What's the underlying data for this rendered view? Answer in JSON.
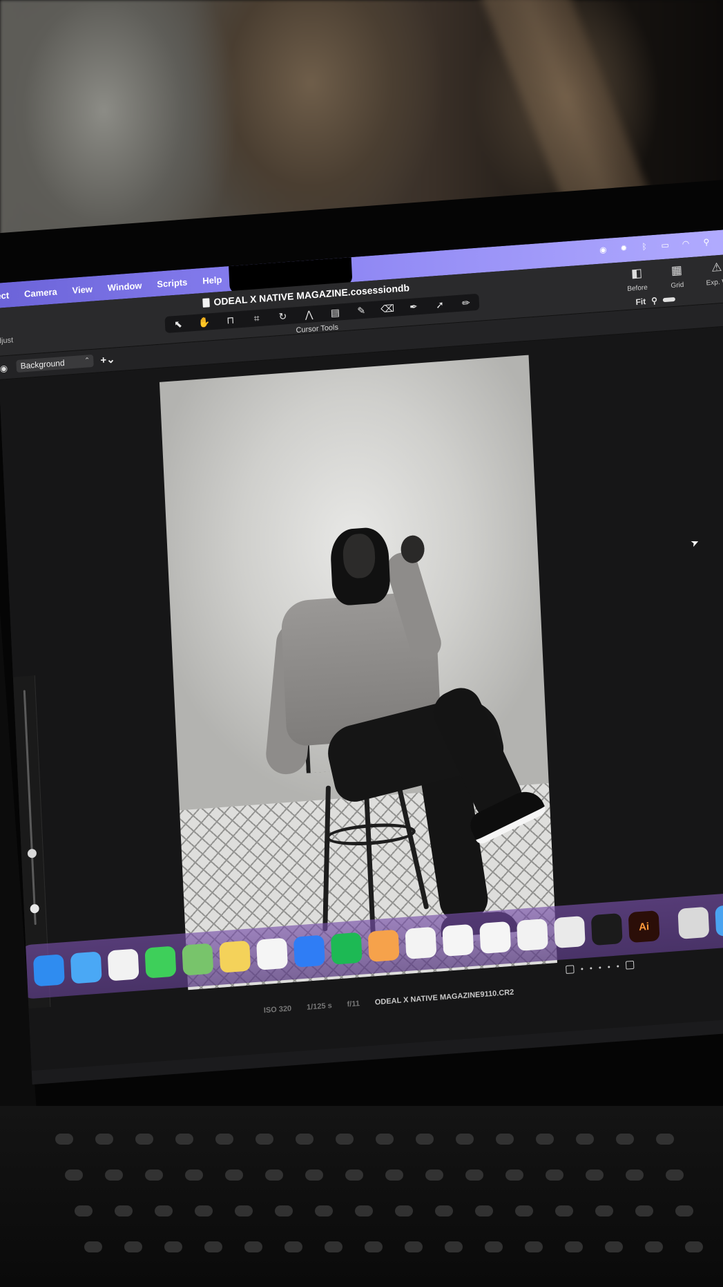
{
  "menubar": {
    "items": [
      "Select",
      "Camera",
      "View",
      "Window",
      "Scripts",
      "Help"
    ]
  },
  "titlebar": {
    "document_title": "ODEAL X NATIVE MAGAZINE.cosessiondb",
    "cursor_tools_label": "Cursor Tools",
    "right_tools": [
      {
        "label": "Before",
        "icon": "before-after-icon"
      },
      {
        "label": "Grid",
        "icon": "grid-icon"
      },
      {
        "label": "Exp. W",
        "icon": "exposure-warning-icon"
      }
    ],
    "fit_label": "Fit"
  },
  "tools": [
    {
      "icon": "pointer-tool-icon",
      "glyph": "⬉",
      "active": false
    },
    {
      "icon": "pan-hand-tool-icon",
      "glyph": "✋",
      "active": true
    },
    {
      "icon": "stamp-tool-icon",
      "glyph": "⊓",
      "active": false
    },
    {
      "icon": "crop-tool-icon",
      "glyph": "⌗",
      "active": false
    },
    {
      "icon": "rotate-tool-icon",
      "glyph": "↻",
      "active": false
    },
    {
      "icon": "keystone-tool-icon",
      "glyph": "⋀",
      "active": false
    },
    {
      "icon": "gradient-mask-tool-icon",
      "glyph": "▤",
      "active": false
    },
    {
      "icon": "brush-tool-icon",
      "glyph": "✎",
      "active": false
    },
    {
      "icon": "eraser-tool-icon",
      "glyph": "⌫",
      "active": false
    },
    {
      "icon": "picker-tool-icon",
      "glyph": "✒",
      "active": false
    },
    {
      "icon": "annotate-tool-icon",
      "glyph": "➚",
      "active": false
    },
    {
      "icon": "pen-tool-icon",
      "glyph": "✏",
      "active": false
    }
  ],
  "adjust_label": "djust",
  "layer_selector": {
    "value": "Background"
  },
  "viewer": {
    "filename": "ODEAL X NATIVE MAGAZINE9110.CR2",
    "iso": "ISO 320",
    "shutter": "1/125 s",
    "aperture": "f/11"
  },
  "dock": {
    "apps": [
      {
        "name": "finder",
        "color": "#2f8cf0",
        "label": ""
      },
      {
        "name": "mail",
        "color": "#4aa8f5",
        "label": ""
      },
      {
        "name": "messages",
        "color": "#f2f2f2",
        "label": ""
      },
      {
        "name": "facetime",
        "color": "#3ecf5a",
        "label": ""
      },
      {
        "name": "maps",
        "color": "#78c46b",
        "label": ""
      },
      {
        "name": "notes",
        "color": "#f4d25a",
        "label": ""
      },
      {
        "name": "reminders",
        "color": "#f5f5f5",
        "label": ""
      },
      {
        "name": "app-store",
        "color": "#2f7df5",
        "label": ""
      },
      {
        "name": "spotify",
        "color": "#1db954",
        "label": ""
      },
      {
        "name": "photos",
        "color": "#f6a24b",
        "label": ""
      },
      {
        "name": "freeform",
        "color": "#f3f3f3",
        "label": ""
      },
      {
        "name": "pages",
        "color": "#f5f5f5",
        "label": ""
      },
      {
        "name": "calendar",
        "color": "#f5f5f5",
        "label": ""
      },
      {
        "name": "chrome",
        "color": "#f2f2f2",
        "label": ""
      },
      {
        "name": "safari",
        "color": "#eaeaea",
        "label": ""
      },
      {
        "name": "capture-one",
        "color": "#1b1b1b",
        "label": ""
      },
      {
        "name": "illustrator",
        "color": "#2b0e08",
        "label": "Ai"
      },
      {
        "name": "archive-utility",
        "color": "#d9d9d9",
        "label": ""
      },
      {
        "name": "downloads",
        "color": "#4aa3f0",
        "label": ""
      },
      {
        "name": "screen-sharing",
        "color": "#4fc3e8",
        "label": ""
      },
      {
        "name": "facetime-2",
        "color": "#3ecf5a",
        "label": ""
      },
      {
        "name": "trash",
        "color": "#555555",
        "label": ""
      }
    ]
  },
  "colors": {
    "menubar_accent": "#8a82f2",
    "active_tool": "#ff7a1a"
  }
}
